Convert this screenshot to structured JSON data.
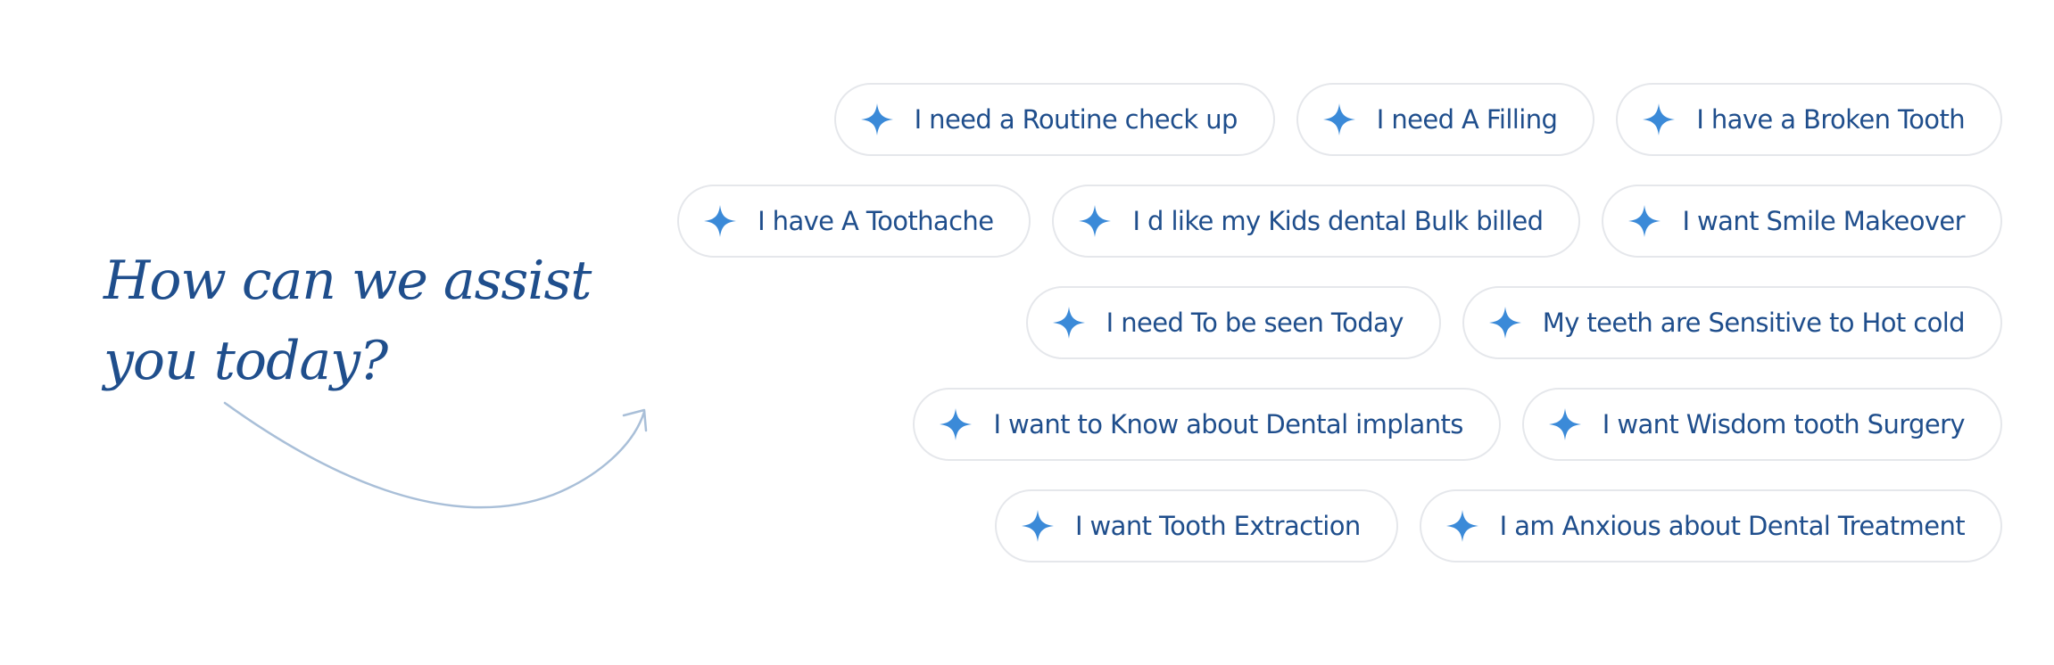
{
  "heading": {
    "line1": "How can we assist",
    "line2": "you today?"
  },
  "colors": {
    "heading": "#1f4e8c",
    "chip_text": "#1f4e8c",
    "sparkle": "#3b8ad8",
    "chip_border": "#e5e7eb",
    "arrow": "#a9bfd8"
  },
  "icons": {
    "chip_icon": "sparkle-icon",
    "decorative": "curved-arrow-icon"
  },
  "chips": [
    [
      "I need a Routine check up",
      "I need A Filling",
      "I have a Broken Tooth"
    ],
    [
      "I have A Toothache",
      "I d like my Kids dental Bulk billed",
      "I want Smile Makeover"
    ],
    [
      "I need To be seen Today",
      "My teeth are Sensitive to Hot cold"
    ],
    [
      "I want to Know about Dental implants",
      "I want Wisdom tooth Surgery"
    ],
    [
      "I want Tooth Extraction",
      "I am Anxious about Dental Treatment"
    ]
  ]
}
